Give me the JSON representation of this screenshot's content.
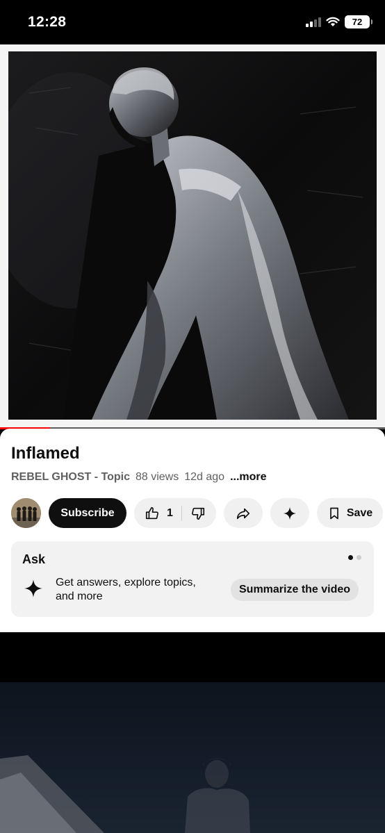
{
  "status_bar": {
    "time": "12:28",
    "battery": "72",
    "icons": [
      "cellular-signal-icon",
      "wifi-icon",
      "battery-icon"
    ]
  },
  "player": {
    "progress": 0.13
  },
  "video": {
    "title": "Inflamed",
    "channel": "REBEL GHOST - Topic",
    "views": "88 views",
    "age": "12d ago",
    "more_label": "...more"
  },
  "actions": {
    "subscribe_label": "Subscribe",
    "like_count": "1",
    "save_label": "Save"
  },
  "ask": {
    "title": "Ask",
    "description": "Get answers, explore topics, and more",
    "suggestion_label": "Summarize the video",
    "pages": 2,
    "active_page": 1
  },
  "colors": {
    "accent": "#ff0000",
    "subscribe_bg": "#0f0f0f",
    "chip_bg": "#f0f0f0"
  }
}
